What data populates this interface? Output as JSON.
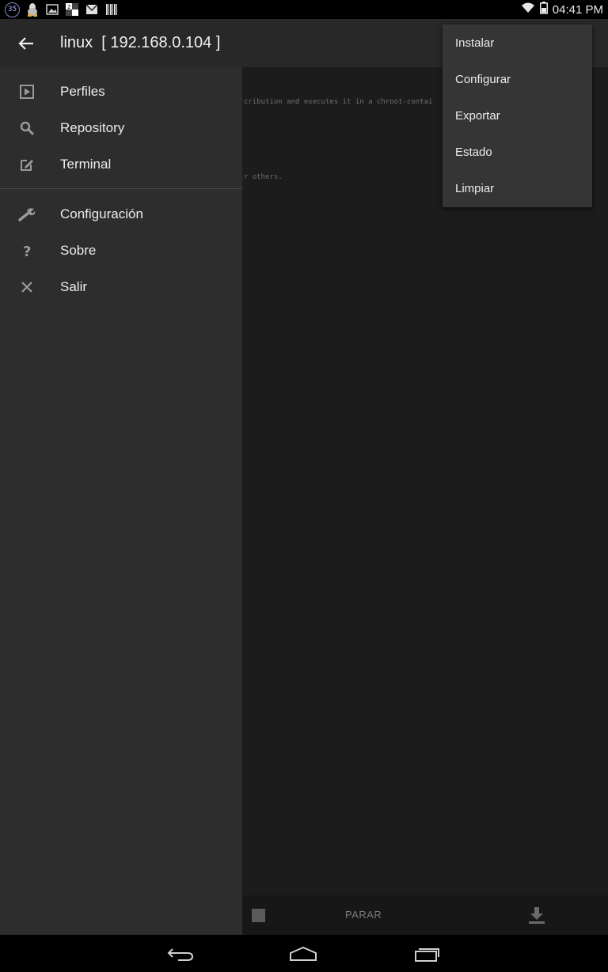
{
  "status_bar": {
    "badge": "35",
    "time": "04:41 PM"
  },
  "app_bar": {
    "title": "linux  [ 192.168.0.104 ]"
  },
  "console": {
    "lines": [
      "cribution and executes it in a chroot-contai",
      "r others."
    ]
  },
  "drawer": {
    "items": [
      {
        "label": "Perfiles",
        "icon": "play-box-icon"
      },
      {
        "label": "Repository",
        "icon": "search-icon"
      },
      {
        "label": "Terminal",
        "icon": "edit-box-icon"
      },
      {
        "label": "Configuración",
        "icon": "wrench-icon"
      },
      {
        "label": "Sobre",
        "icon": "question-icon"
      },
      {
        "label": "Salir",
        "icon": "close-icon"
      }
    ]
  },
  "overflow_menu": {
    "items": [
      {
        "label": "Instalar"
      },
      {
        "label": "Configurar"
      },
      {
        "label": "Exportar"
      },
      {
        "label": "Estado"
      },
      {
        "label": "Limpiar"
      }
    ]
  },
  "bottom_bar": {
    "stop_label": "PARAR"
  },
  "colors": {
    "drawer_bg": "#2d2d2d",
    "app_bar_bg": "#282828",
    "menu_bg": "#353535"
  }
}
